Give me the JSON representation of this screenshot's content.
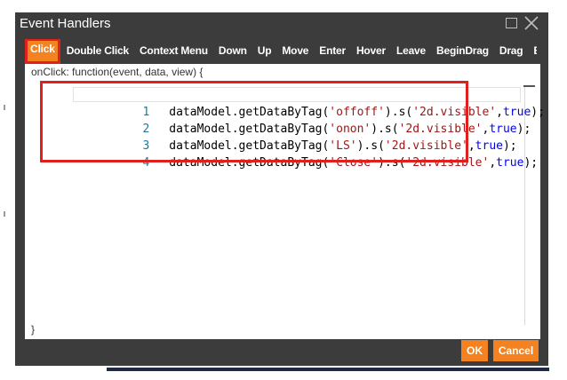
{
  "dialog": {
    "title": "Event Handlers"
  },
  "tabs": [
    {
      "label": "Click",
      "active": true
    },
    {
      "label": "Double Click"
    },
    {
      "label": "Context Menu"
    },
    {
      "label": "Down"
    },
    {
      "label": "Up"
    },
    {
      "label": "Move"
    },
    {
      "label": "Enter"
    },
    {
      "label": "Hover"
    },
    {
      "label": "Leave"
    },
    {
      "label": "BeginDrag"
    },
    {
      "label": "Drag"
    },
    {
      "label": "E"
    }
  ],
  "editor": {
    "header": "onClick: function(event, data, view) {",
    "footer": "}",
    "lines": [
      {
        "num": "1",
        "prefix": "dataModel.getDataByTag(",
        "tag": "'offoff'",
        "mid": ").s(",
        "prop": "'2d.visible'",
        "comma": ",",
        "value": "true",
        "suffix": ");"
      },
      {
        "num": "2",
        "prefix": "dataModel.getDataByTag(",
        "tag": "'onon'",
        "mid": ").s(",
        "prop": "'2d.visible'",
        "comma": ",",
        "value": "true",
        "suffix": ");"
      },
      {
        "num": "3",
        "prefix": "dataModel.getDataByTag(",
        "tag": "'LS'",
        "mid": ").s(",
        "prop": "'2d.visible'",
        "comma": ",",
        "value": "true",
        "suffix": ");"
      },
      {
        "num": "4",
        "prefix": "dataModel.getDataByTag(",
        "tag": "'Close'",
        "mid": ").s(",
        "prop": "'2d.visible'",
        "comma": ",",
        "value": "true",
        "suffix": ");"
      }
    ]
  },
  "buttons": {
    "ok": "OK",
    "cancel": "Cancel"
  },
  "colors": {
    "accent": "#f58220",
    "highlight": "#e0201c",
    "dialog_bg": "#3c3c3c"
  },
  "icons": {
    "maximize": "maximize-icon",
    "close": "close-icon"
  }
}
